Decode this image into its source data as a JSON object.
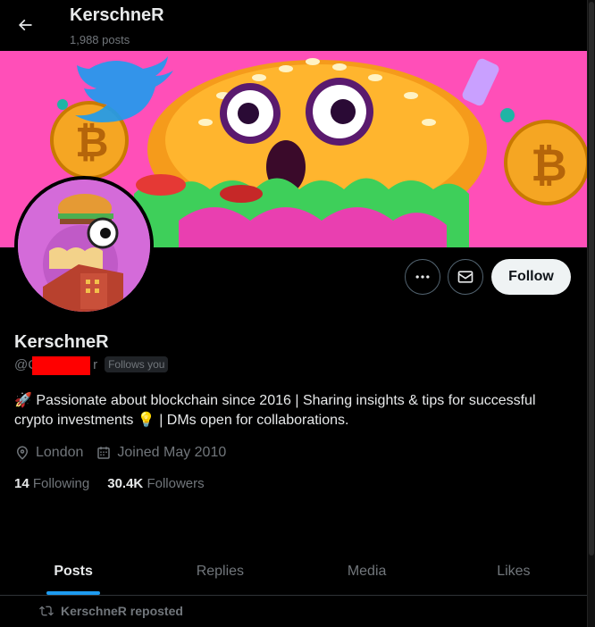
{
  "header": {
    "back_icon": "arrow-left-icon",
    "name": "KerschneR",
    "posts_count": "1,988 posts"
  },
  "banner": {
    "description_icon": "banner-image"
  },
  "actions": {
    "more_icon": "more-horizontal-icon",
    "message_icon": "mail-icon",
    "follow_label": "Follow"
  },
  "profile": {
    "name": "KerschneR",
    "handle_prefix": "@",
    "handle_first": "C",
    "handle_last": "r",
    "follows_you": "Follows you",
    "bio_line1": "🚀 Passionate about blockchain since 2016 | Sharing insights & tips for successful",
    "bio_line2": "crypto investments 💡 | DMs open for collaborations.",
    "location": "London",
    "joined": "Joined May 2010",
    "following_count": "14",
    "following_label": "Following",
    "followers_count": "30.4K",
    "followers_label": "Followers"
  },
  "tabs": [
    {
      "label": "Posts",
      "active": true
    },
    {
      "label": "Replies",
      "active": false
    },
    {
      "label": "Media",
      "active": false
    },
    {
      "label": "Likes",
      "active": false
    }
  ],
  "feed": {
    "repost_label": "KerschneR reposted"
  },
  "colors": {
    "background": "#000000",
    "accent": "#1d9bf0",
    "text_primary": "#e7e9ea",
    "text_secondary": "#71767b",
    "banner_pink": "#ff4fb8",
    "redaction": "#ff0000"
  }
}
